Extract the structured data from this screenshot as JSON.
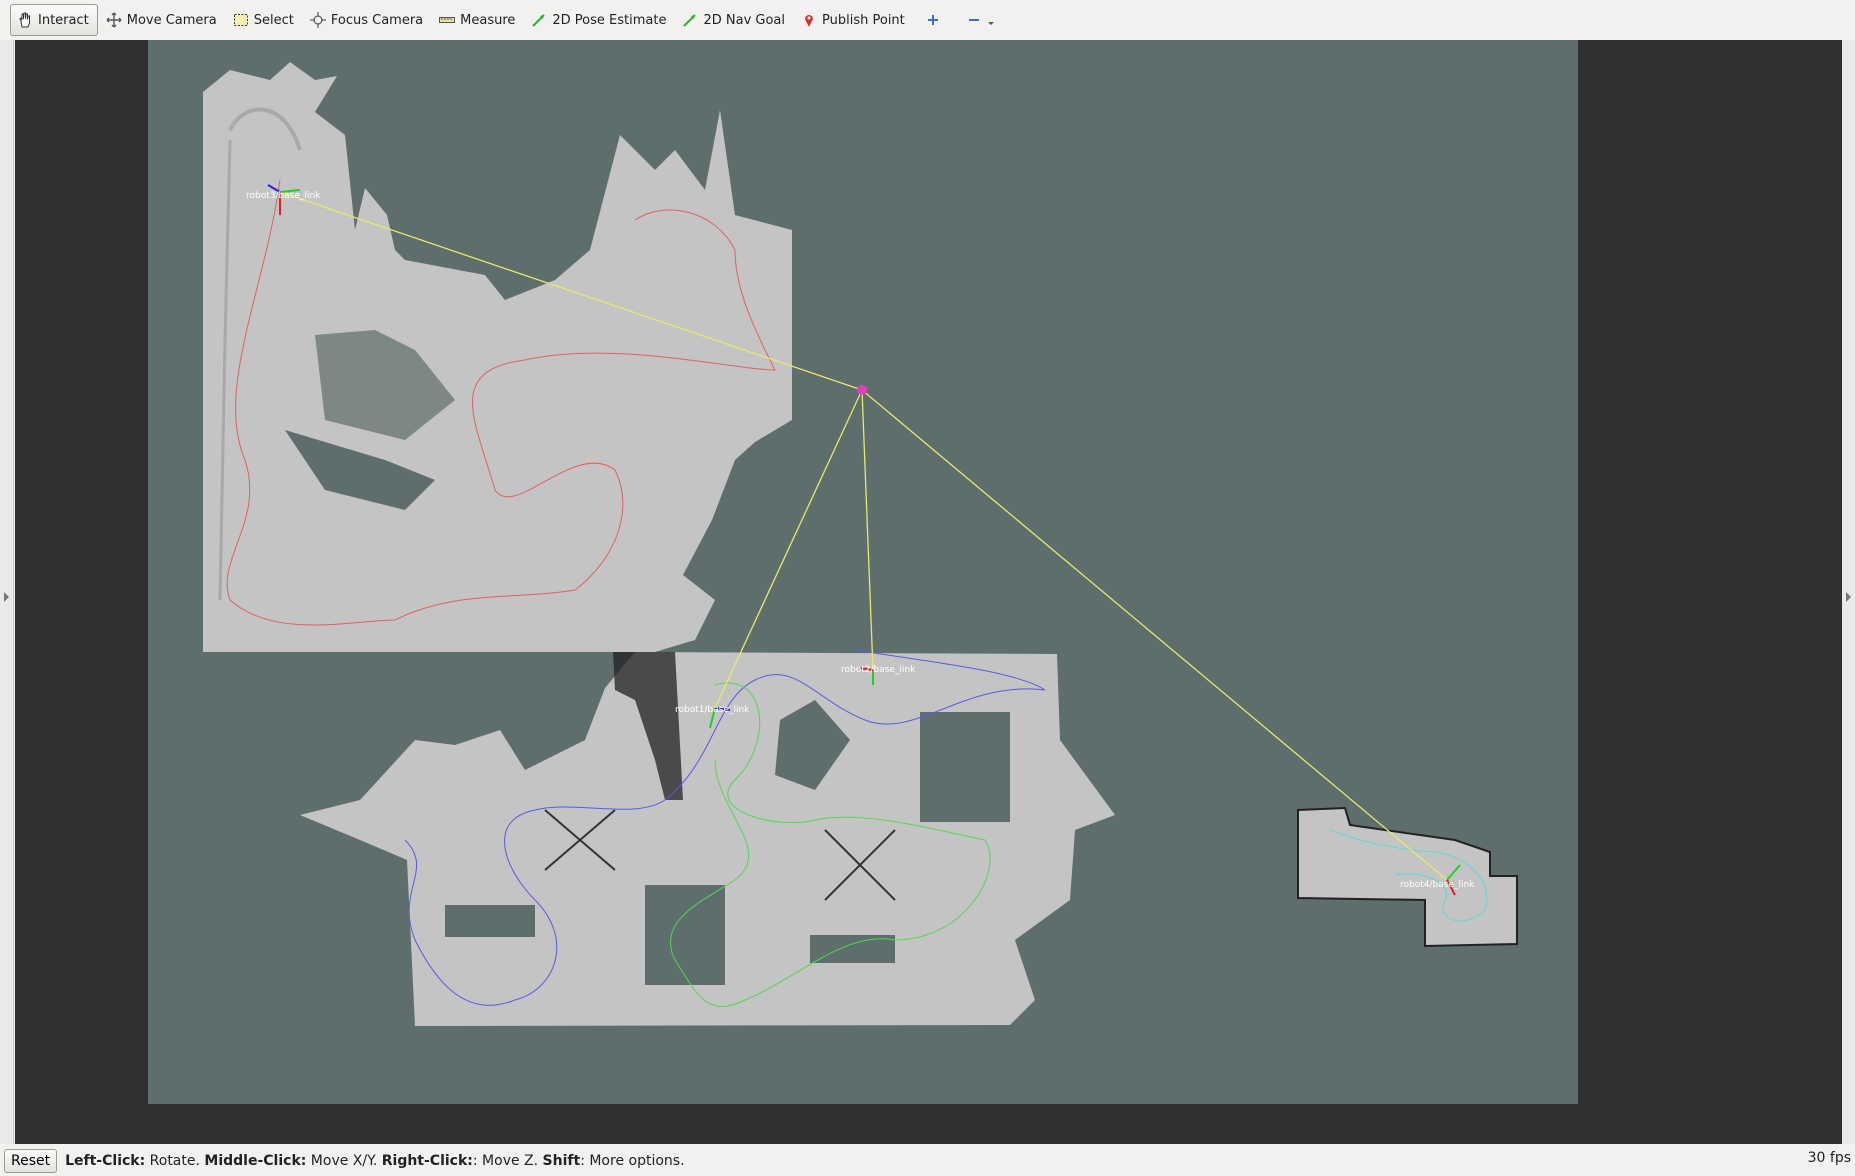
{
  "toolbar": {
    "tools": [
      {
        "label": "Interact",
        "icon": "hand-icon"
      },
      {
        "label": "Move Camera",
        "icon": "move-camera-icon"
      },
      {
        "label": "Select",
        "icon": "select-box-icon"
      },
      {
        "label": "Focus Camera",
        "icon": "focus-camera-icon"
      },
      {
        "label": "Measure",
        "icon": "ruler-icon"
      },
      {
        "label": "2D Pose Estimate",
        "icon": "green-arrow-icon"
      },
      {
        "label": "2D Nav Goal",
        "icon": "green-arrow-icon"
      },
      {
        "label": "Publish Point",
        "icon": "map-pin-icon"
      }
    ],
    "add_icon": "plus-icon",
    "remove_icon": "minus-icon",
    "active_tool": "Interact"
  },
  "viewport": {
    "background_color": "#303030",
    "map_background_color": "#5e6e6c",
    "free_space_color": "#c4c4c4",
    "link_line_color": "#e8e86a",
    "robots": [
      {
        "label": "robot3/base_link",
        "path_color": "#e06060"
      },
      {
        "label": "robot2/base_link",
        "path_color": "#5a5ae6"
      },
      {
        "label": "robot1/base_link",
        "path_color": "#50d850"
      },
      {
        "label": "robot4/base_link",
        "path_color": "#60d8d8"
      }
    ],
    "hub_color": "#e040c0"
  },
  "statusbar": {
    "reset_label": "Reset",
    "hint": [
      {
        "b": "Left-Click:",
        "t": " Rotate. "
      },
      {
        "b": "Middle-Click:",
        "t": " Move X/Y. "
      },
      {
        "b": "Right-Click:",
        "t": ": Move Z. "
      },
      {
        "b": "Shift",
        "t": ": More options."
      }
    ],
    "fps": "30 fps"
  }
}
